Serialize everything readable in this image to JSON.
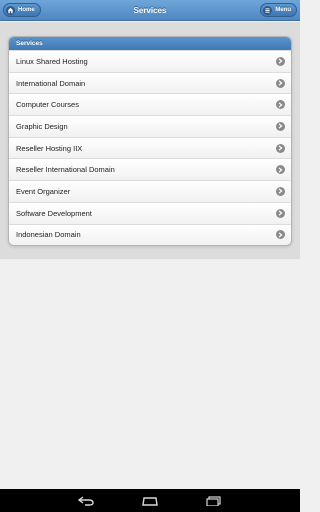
{
  "header": {
    "title": "Services",
    "home_label": "Home",
    "menu_label": "Menu"
  },
  "list": {
    "section_label": "Services",
    "items": [
      {
        "label": "Linux Shared Hosting"
      },
      {
        "label": "International Domain"
      },
      {
        "label": "Computer Courses"
      },
      {
        "label": "Graphic Design"
      },
      {
        "label": "Reseller Hosting IIX"
      },
      {
        "label": "Reseller International Domain"
      },
      {
        "label": "Event Organizer"
      },
      {
        "label": "Software Development"
      },
      {
        "label": "Indonesian Domain"
      }
    ]
  },
  "icons": {
    "home": "home-icon",
    "menu": "menu-icon",
    "item_arrow": "chevron-right-icon",
    "back": "back-icon",
    "nav_home": "home-nav-icon",
    "recents": "recent-apps-icon"
  },
  "colors": {
    "header": "#4e87c2",
    "divider": "#3f79b6"
  }
}
